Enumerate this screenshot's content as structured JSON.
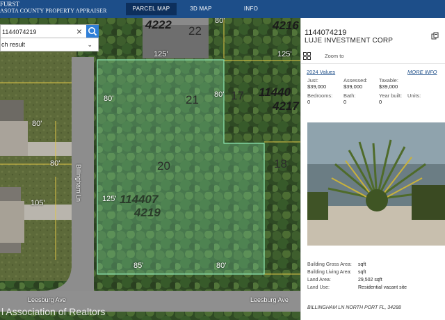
{
  "header": {
    "brand_line1": "FURST",
    "brand_line2": "ASOTA COUNTY PROPERTY APPRAISER",
    "tabs": [
      {
        "label": "PARCEL MAP",
        "active": true
      },
      {
        "label": "3D MAP",
        "active": false
      },
      {
        "label": "INFO",
        "active": false
      }
    ]
  },
  "search": {
    "value": "1144074219",
    "result_label": "ch result"
  },
  "map": {
    "lot_labels": {
      "l22": "22",
      "l21": "21",
      "l20": "20",
      "l17": "17",
      "l18": "18",
      "l4222": "4222",
      "l4216": "4216",
      "l11440_top": "11440",
      "l4217": "4217"
    },
    "parcel_label_line1": "114407",
    "parcel_label_line2": "4219",
    "dimensions": {
      "d125_top": "125'",
      "d125_right": "125'",
      "d80_top": "80'",
      "d80_top_right": "80'",
      "d80_left": "80'",
      "d80_house": "80'",
      "d125_left": "125'",
      "d85_bottom": "85'",
      "d80_bottom": "80'",
      "d105": "105'",
      "d80_upper": "80'"
    },
    "streets": {
      "billingham": "Billingham Ln",
      "leesburg_left": "Leesburg Ave",
      "leesburg_right": "Leesburg Ave"
    },
    "watermark": "l Association of Realtors",
    "colors": {
      "parcel_highlight": "#7fd9a6",
      "road": "#8d8d8d",
      "grass": "#5d6a3a"
    }
  },
  "panel": {
    "parcel_id": "1144074219",
    "owner": "LUJE INVESTMENT CORP",
    "zoom_label": "Zoom to",
    "values_heading": "2024 Values",
    "more_info": "MORE INFO",
    "values": [
      {
        "label": "Just:",
        "value": "$39,000"
      },
      {
        "label": "Assessed:",
        "value": "$39,000"
      },
      {
        "label": "Taxable:",
        "value": "$39,000"
      },
      {
        "label": "Bedrooms:",
        "value": "0"
      },
      {
        "label": "Bath:",
        "value": "0"
      },
      {
        "label": "Year built:",
        "value": "0"
      },
      {
        "label": "Units:",
        "value": ""
      }
    ],
    "details": [
      {
        "label": "Building Gross Area:",
        "value": "sqft"
      },
      {
        "label": "Building Living Area:",
        "value": "sqft"
      },
      {
        "label": "Land Area:",
        "value": "29,502 sqft"
      },
      {
        "label": "Land Use:",
        "value": "Residential vacant site"
      }
    ],
    "address": "BILLINGHAM LN NORTH PORT FL, 34288"
  }
}
